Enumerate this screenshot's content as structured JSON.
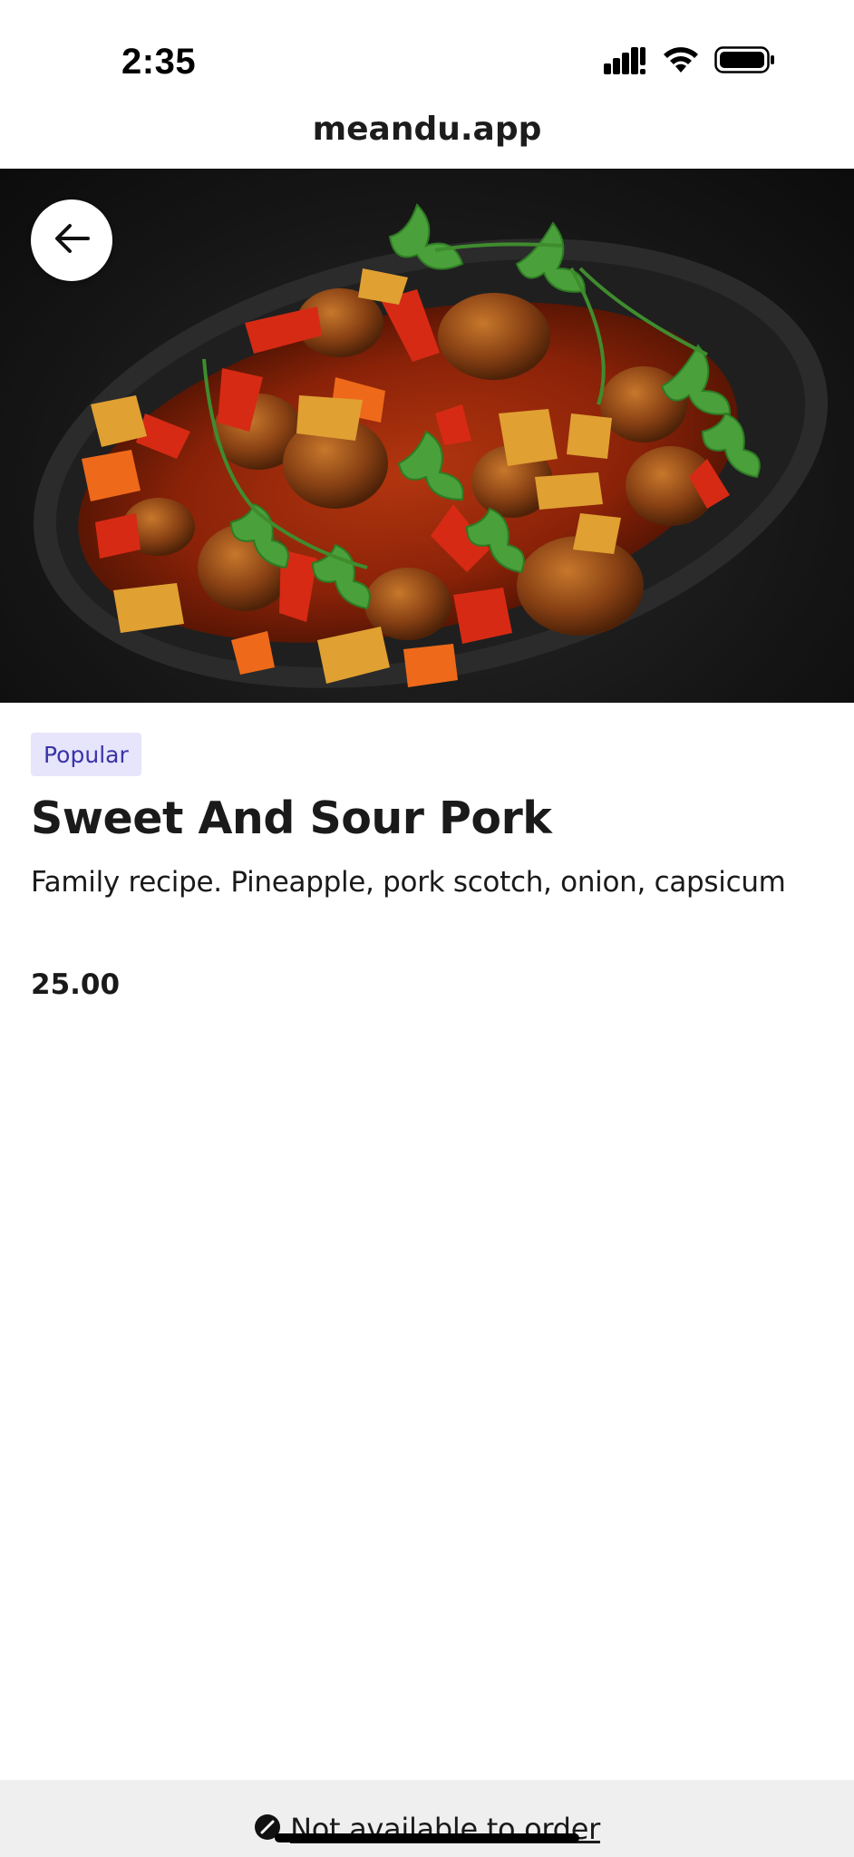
{
  "status_bar": {
    "time": "2:35",
    "icons": [
      "cellular-signal-icon",
      "wifi-icon",
      "battery-icon"
    ]
  },
  "browser": {
    "url": "meandu.app"
  },
  "item": {
    "badge": "Popular",
    "title": "Sweet And Sour Pork",
    "description": "Family recipe. Pineapple, pork scotch, onion, capsicum",
    "price": "25.00"
  },
  "footer": {
    "status_icon": "blocked-icon",
    "label": "Not available to order"
  },
  "colors": {
    "badge_bg": "#e6e5fb",
    "badge_text": "#3a33a8",
    "footer_bg": "#efefef"
  }
}
